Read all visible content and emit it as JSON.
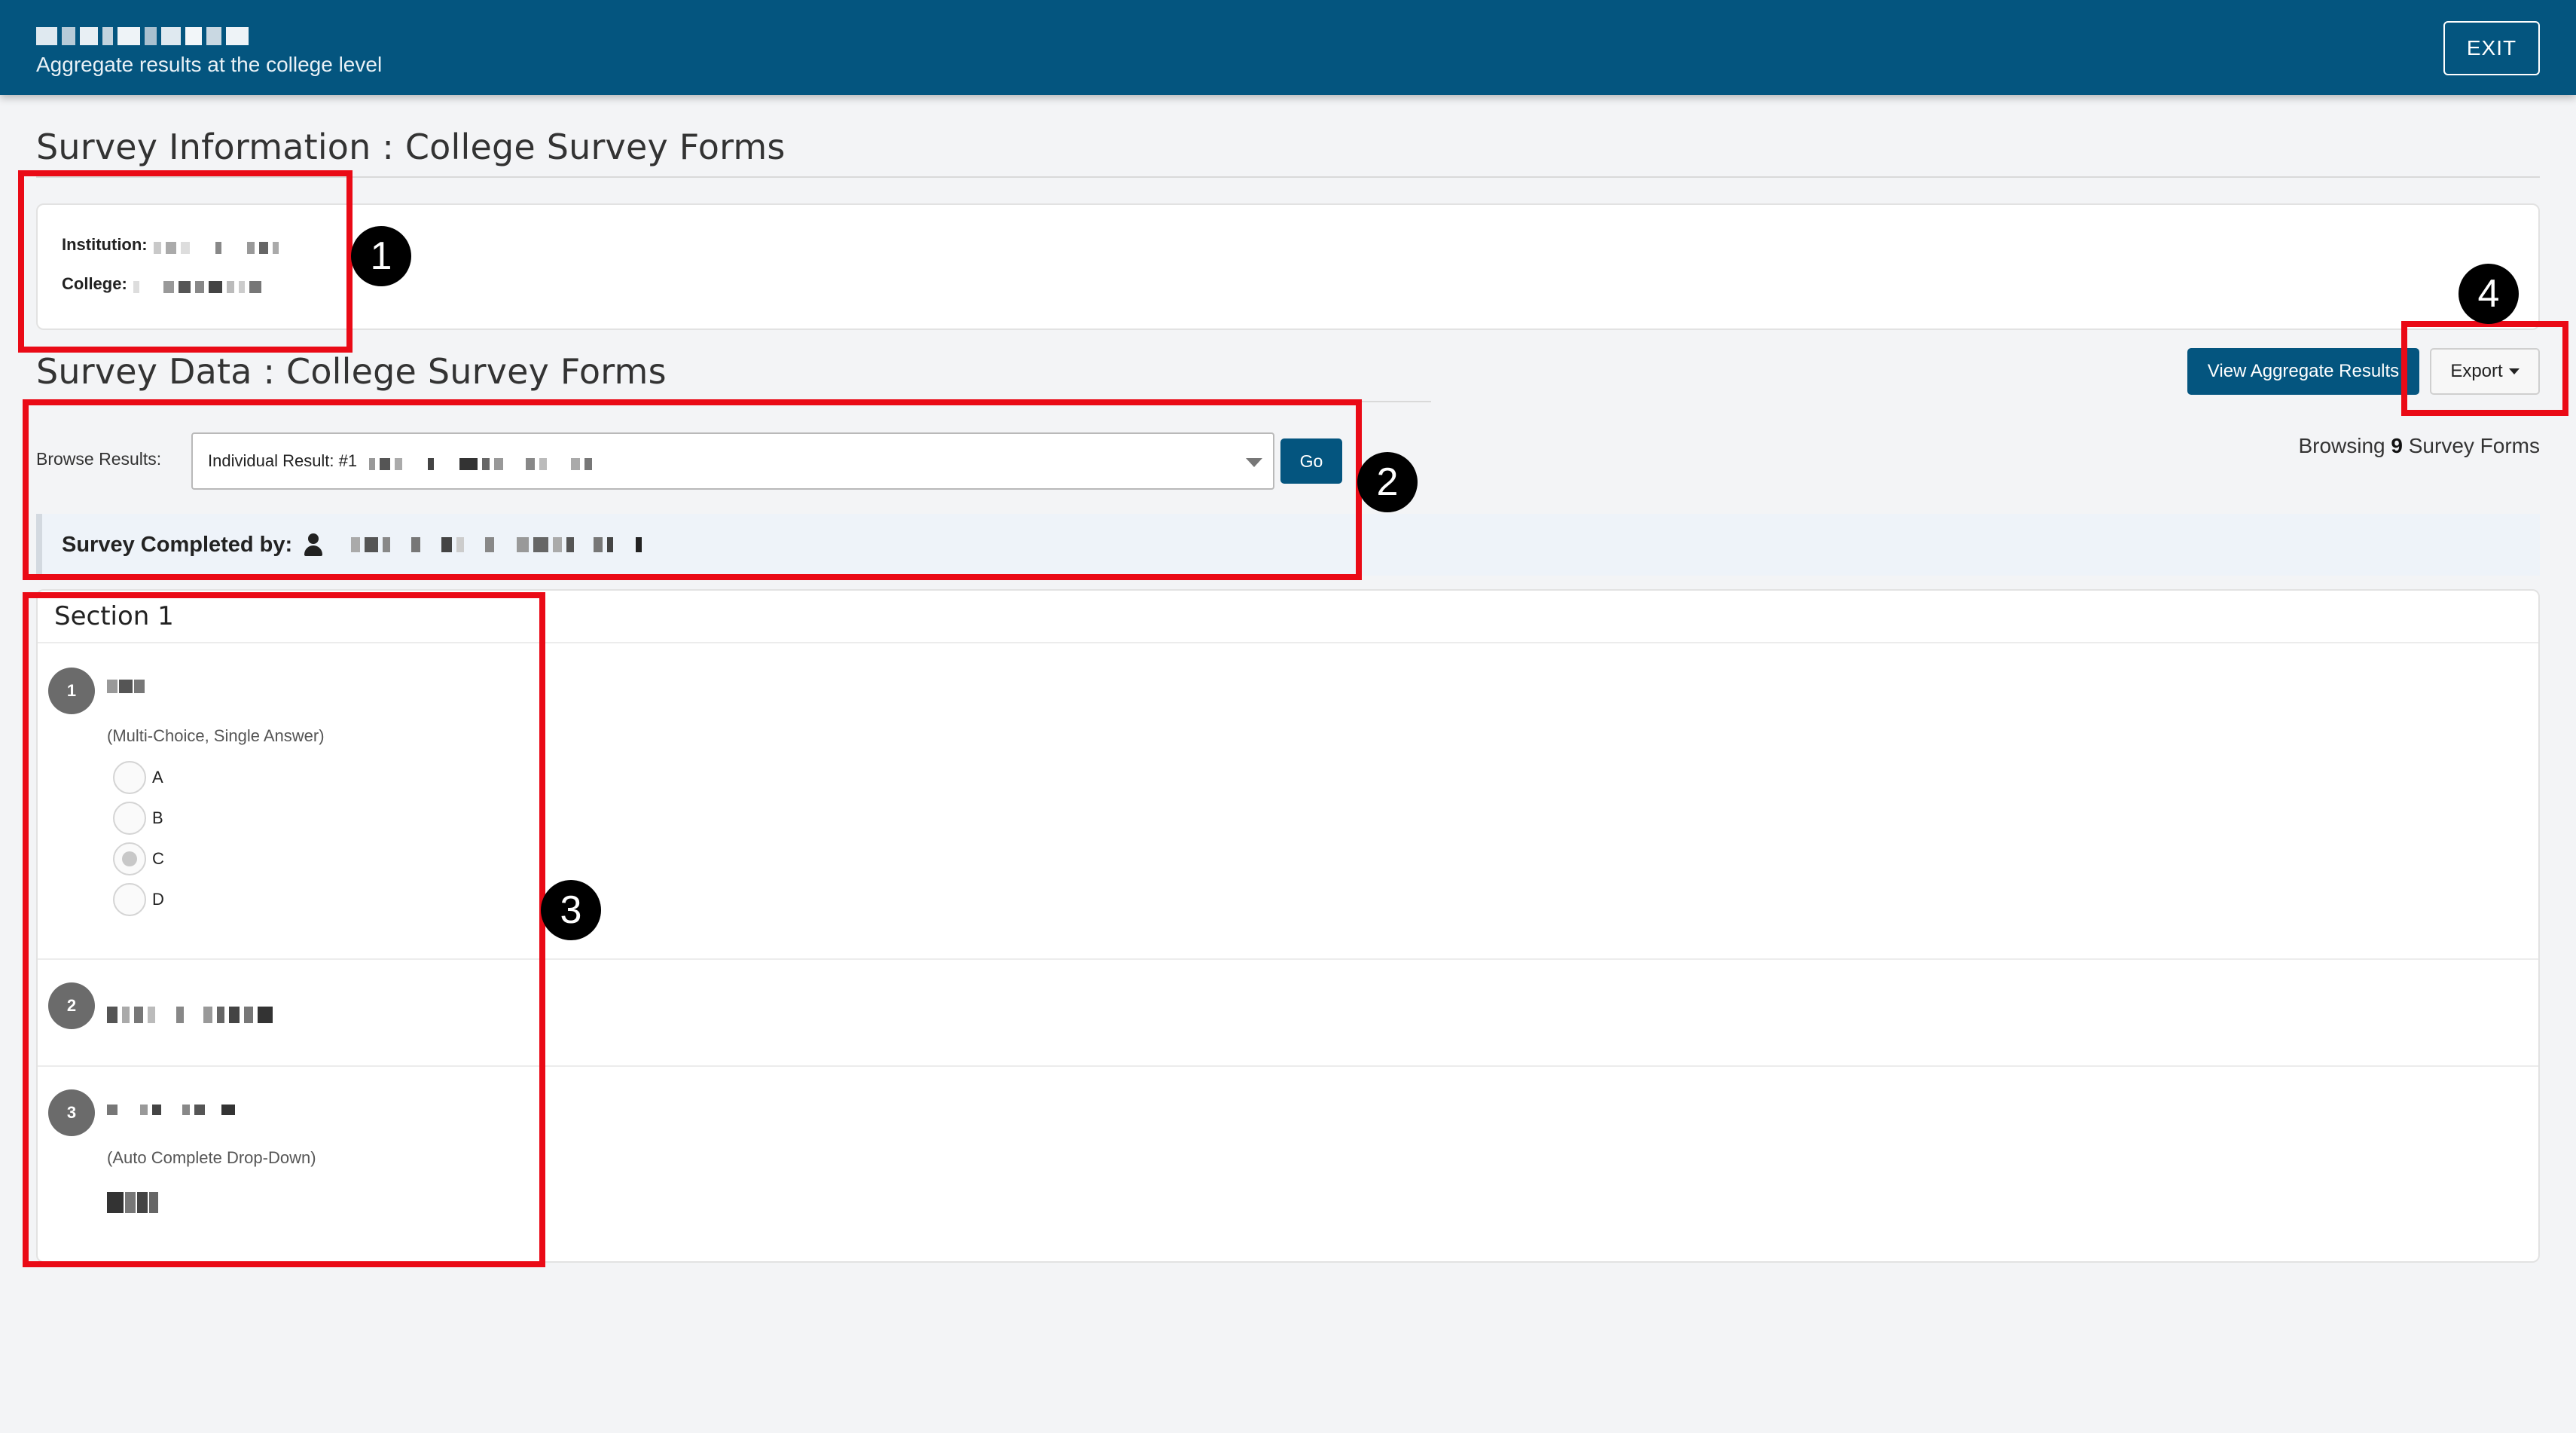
{
  "header": {
    "app_name_redacted": true,
    "subtitle": "Aggregate results at the college level",
    "exit_label": "EXIT"
  },
  "survey_info": {
    "title": "Survey Information : College Survey Forms",
    "institution_label": "Institution:",
    "college_label": "College:"
  },
  "survey_data": {
    "title": "Survey Data : College Survey Forms",
    "view_aggregate_label": "View Aggregate Results",
    "export_label": "Export",
    "browsing_prefix": "Browsing",
    "browsing_count": "9",
    "browsing_suffix": "Survey Forms",
    "browse_label": "Browse Results:",
    "select_value": "Individual Result: #1",
    "go_label": "Go",
    "completed_by_label": "Survey Completed by:"
  },
  "section": {
    "title": "Section 1",
    "questions": [
      {
        "number": "1",
        "type": "(Multi-Choice, Single Answer)",
        "options": [
          "A",
          "B",
          "C",
          "D"
        ],
        "selected": "C"
      },
      {
        "number": "2"
      },
      {
        "number": "3",
        "type": "(Auto Complete Drop-Down)"
      }
    ]
  },
  "annotations": [
    "1",
    "2",
    "3",
    "4"
  ],
  "colors": {
    "brand": "#04557f",
    "annotation": "#ea0a16"
  }
}
